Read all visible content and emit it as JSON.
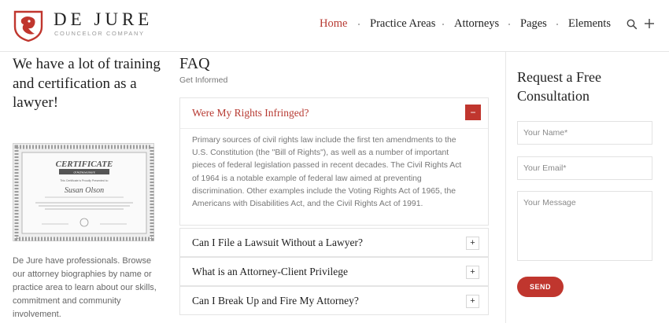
{
  "brand": {
    "title": "DE JURE",
    "subtitle": "COUNCELOR COMPANY",
    "accent_color": "#c0362e"
  },
  "nav": {
    "items": [
      {
        "label": "Home",
        "active": true
      },
      {
        "label": "Practice Areas",
        "active": false
      },
      {
        "label": "Attorneys",
        "active": false
      },
      {
        "label": "Pages",
        "active": false
      },
      {
        "label": "Elements",
        "active": false
      }
    ],
    "icons": [
      "search-icon",
      "plus-icon"
    ]
  },
  "left": {
    "heading": "We have a lot of training and certification as a lawyer!",
    "certificate": {
      "title": "CERTIFICATE",
      "ribbon": "of Achievement",
      "presented": "This Certificate is Proudly Presented to:",
      "name": "Susan Olson"
    },
    "text": "De Jure have professionals. Browse our attorney biographies by name or practice area to learn about our skills, commitment and community involvement."
  },
  "faq": {
    "title": "FAQ",
    "subtitle": "Get Informed",
    "open_item": {
      "question": "Were My Rights Infringed?",
      "toggle": "−",
      "answer": "Primary sources of civil rights law include the first ten amendments to the U.S. Constitution (the \"Bill of Rights\"), as well as a number of important pieces of federal legislation passed in recent decades. The Civil Rights Act of 1964 is a notable example of federal law aimed at preventing discrimination. Other examples include the Voting Rights Act of 1965, the Americans with Disabilities Act, and the Civil Rights Act of 1991."
    },
    "items": [
      {
        "question": "Can I File a Lawsuit Without a Lawyer?",
        "toggle": "+"
      },
      {
        "question": "What is an Attorney-Client Privilege",
        "toggle": "+"
      },
      {
        "question": "Can I Break Up and Fire My Attorney?",
        "toggle": "+"
      }
    ]
  },
  "consultation": {
    "title": "Request a Free Consultation",
    "name_placeholder": "Your Name*",
    "email_placeholder": "Your Email*",
    "message_placeholder": "Your Message",
    "send_label": "SEND"
  }
}
